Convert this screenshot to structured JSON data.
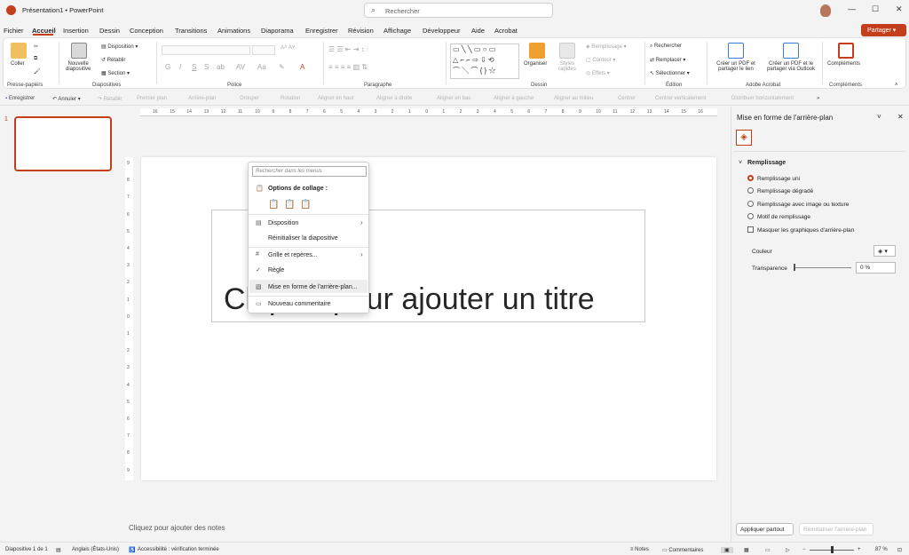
{
  "window": {
    "title": "Présentation1  •  PowerPoint"
  },
  "search": {
    "placeholder": "Rechercher"
  },
  "share": {
    "label": "Partager"
  },
  "tabs": [
    "Fichier",
    "Accueil",
    "Insertion",
    "Dessin",
    "Conception",
    "Transitions",
    "Animations",
    "Diaporama",
    "Enregistrer",
    "Révision",
    "Affichage",
    "Développeur",
    "Aide",
    "Acrobat"
  ],
  "ribbon": {
    "coller": "Coller",
    "nouvelle_diapo": "Nouvelle\ndiapositive",
    "disposition": "Disposition",
    "retablir": "Rétablir",
    "section": "Section",
    "organiser": "Organiser",
    "styles_rapides": "Styles rapides",
    "remplissage": "Remplissage",
    "contour": "Contour",
    "effets": "Effets",
    "rechercher": "Rechercher",
    "remplacer": "Remplacer",
    "selectionner": "Sélectionner",
    "creer_pdf": "Créer un PDF et partager le lien",
    "creer_pdf_outlook": "Créer un PDF et le partager via Outlook",
    "complements": "Compléments",
    "groups": {
      "presse": "Presse-papiers",
      "diapos": "Diapositives",
      "police": "Police",
      "paragraphe": "Paragraphe",
      "dessin": "Dessin",
      "edition": "Édition",
      "acrobat": "Adobe Acrobat",
      "complements": "Compléments"
    }
  },
  "qat": {
    "enregistrer": "Enregistrer",
    "annuler": "Annuler",
    "retablir": "Rétablir",
    "items": [
      "Premier plan",
      "Arrière-plan",
      "Grouper",
      "Rotation",
      "Aligner en haut",
      "Aligner à droite",
      "Aligner en bas",
      "Aligner à gauche",
      "Aligner au milieu",
      "Centrer",
      "Centrer verticalement",
      "Distribuer horizontalement"
    ]
  },
  "slide": {
    "number": "1",
    "title_placeholder": "Cliquez pour ajouter un titre",
    "notes": "Cliquez pour ajouter des notes"
  },
  "context_menu": {
    "search": "Rechercher dans les menus",
    "paste_header": "Options de collage :",
    "disposition": "Disposition",
    "reinit": "Réinitialiser la diapositive",
    "grille": "Grille et repères...",
    "regle": "Règle",
    "mise_en_forme": "Mise en forme de l'arrière-plan...",
    "commentaire": "Nouveau commentaire"
  },
  "pane": {
    "title": "Mise en forme de l'arrière-plan",
    "section": "Remplissage",
    "options": [
      "Remplissage uni",
      "Remplissage dégradé",
      "Remplissage avec image ou texture",
      "Motif de remplissage"
    ],
    "selected_index": 0,
    "masquer": "Masquer les graphiques d'arrière-plan",
    "couleur": "Couleur",
    "transparence": "Transparence",
    "transparence_value": "0 %",
    "appliquer": "Appliquer partout",
    "reinitialiser": "Réinitialiser l'arrière-plan"
  },
  "status": {
    "slide": "Diapositive 1 de 1",
    "lang": "Anglais (États-Unis)",
    "access": "Accessibilité : vérification terminée",
    "notes": "Notes",
    "comments": "Commentaires",
    "zoom": "87 %"
  },
  "colors": {
    "accent": "#c43e1c"
  }
}
